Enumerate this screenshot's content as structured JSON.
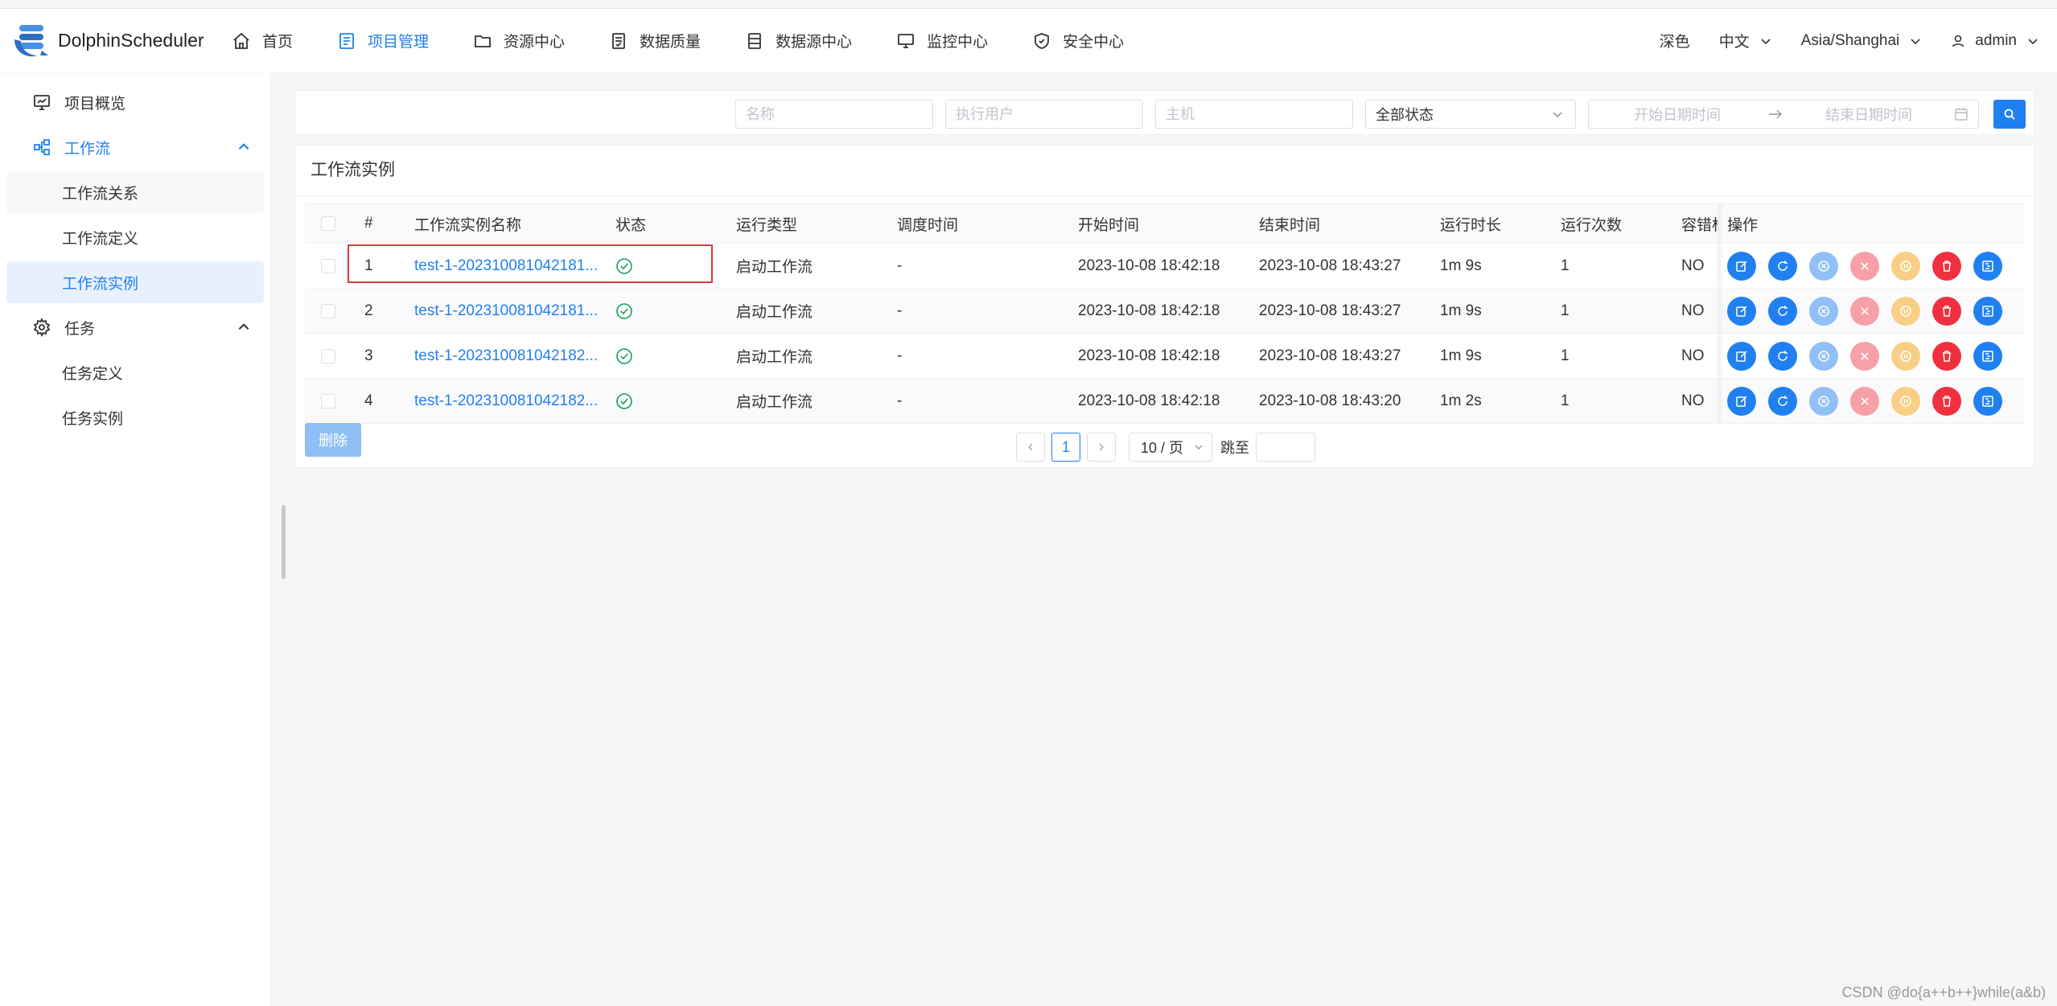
{
  "app": {
    "logo_text": "DolphinScheduler"
  },
  "nav": [
    {
      "label": "首页",
      "icon": "home-icon",
      "active": false
    },
    {
      "label": "项目管理",
      "icon": "project-icon",
      "active": true
    },
    {
      "label": "资源中心",
      "icon": "folder-icon",
      "active": false
    },
    {
      "label": "数据质量",
      "icon": "data-quality-icon",
      "active": false
    },
    {
      "label": "数据源中心",
      "icon": "datasource-icon",
      "active": false
    },
    {
      "label": "监控中心",
      "icon": "monitor-icon",
      "active": false
    },
    {
      "label": "安全中心",
      "icon": "shield-icon",
      "active": false
    }
  ],
  "header_right": {
    "theme": "深色",
    "language": "中文",
    "timezone": "Asia/Shanghai",
    "user": "admin"
  },
  "sidebar": {
    "overview": "项目概览",
    "workflow": "工作流",
    "workflow_children": [
      "工作流关系",
      "工作流定义",
      "工作流实例"
    ],
    "task": "任务",
    "task_children": [
      "任务定义",
      "任务实例"
    ]
  },
  "filters": {
    "name_placeholder": "名称",
    "executor_placeholder": "执行用户",
    "host_placeholder": "主机",
    "status_value": "全部状态",
    "start_placeholder": "开始日期时间",
    "end_placeholder": "结束日期时间"
  },
  "table": {
    "title": "工作流实例",
    "headers": {
      "index": "#",
      "name": "工作流实例名称",
      "status": "状态",
      "run_type": "运行类型",
      "schedule_time": "调度时间",
      "start_time": "开始时间",
      "end_time": "结束时间",
      "duration": "运行时长",
      "run_times": "运行次数",
      "fault_tolerant": "容错标",
      "operation": "操作"
    },
    "rows": [
      {
        "index": "1",
        "name": "test-1-202310081042181...",
        "status": "success",
        "run_type": "启动工作流",
        "schedule_time": "-",
        "start_time": "2023-10-08 18:42:18",
        "end_time": "2023-10-08 18:43:27",
        "duration": "1m 9s",
        "run_times": "1",
        "fault_tolerant": "NO"
      },
      {
        "index": "2",
        "name": "test-1-202310081042181...",
        "status": "success",
        "run_type": "启动工作流",
        "schedule_time": "-",
        "start_time": "2023-10-08 18:42:18",
        "end_time": "2023-10-08 18:43:27",
        "duration": "1m 9s",
        "run_times": "1",
        "fault_tolerant": "NO"
      },
      {
        "index": "3",
        "name": "test-1-202310081042182...",
        "status": "success",
        "run_type": "启动工作流",
        "schedule_time": "-",
        "start_time": "2023-10-08 18:42:18",
        "end_time": "2023-10-08 18:43:27",
        "duration": "1m 9s",
        "run_times": "1",
        "fault_tolerant": "NO"
      },
      {
        "index": "4",
        "name": "test-1-202310081042182...",
        "status": "success",
        "run_type": "启动工作流",
        "schedule_time": "-",
        "start_time": "2023-10-08 18:42:18",
        "end_time": "2023-10-08 18:43:20",
        "duration": "1m 2s",
        "run_times": "1",
        "fault_tolerant": "NO"
      }
    ],
    "delete_label": "删除"
  },
  "pagination": {
    "current_page": "1",
    "page_size": "10 / 页",
    "jump_label": "跳至"
  },
  "colors": {
    "accent": "#2080f0",
    "success": "#18a058",
    "danger": "#f0303e",
    "highlight_border": "#d93a3a"
  },
  "watermark": "CSDN @do{a++b++}while(a&b)"
}
